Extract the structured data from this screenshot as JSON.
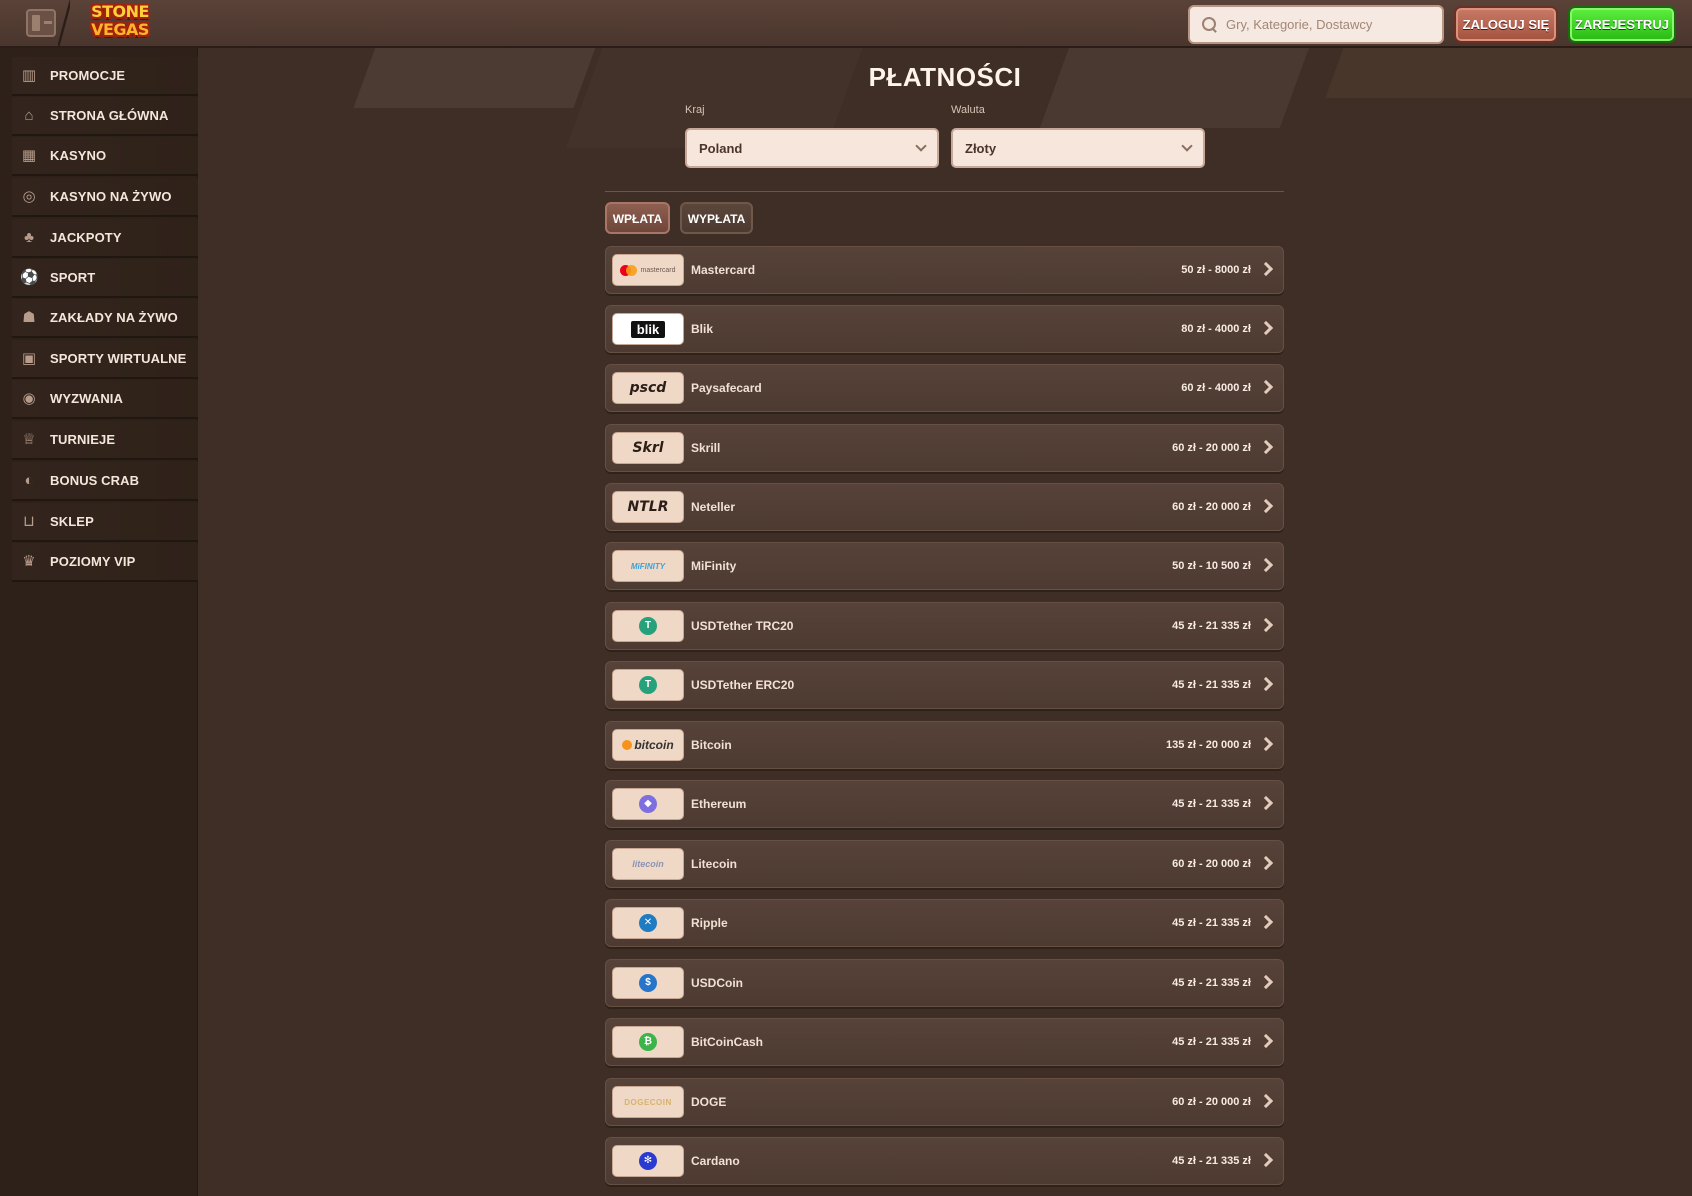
{
  "header": {
    "logo_line1": "STONE",
    "logo_line2": "VEGAS",
    "search_placeholder": "Gry, Kategorie, Dostawcy",
    "login_label": "ZALOGUJ SIĘ",
    "register_label": "ZAREJESTRUJ"
  },
  "sidebar": {
    "items": [
      {
        "label": "PROMOCJE",
        "icon": "gift-icon"
      },
      {
        "label": "STRONA GŁÓWNA",
        "icon": "home-icon"
      },
      {
        "label": "KASYNO",
        "icon": "casino-icon"
      },
      {
        "label": "KASYNO NA ŻYWO",
        "icon": "live-casino-icon"
      },
      {
        "label": "JACKPOTY",
        "icon": "clover-icon"
      },
      {
        "label": "SPORT",
        "icon": "ball-icon"
      },
      {
        "label": "ZAKŁADY NA ŻYWO",
        "icon": "live-bet-icon"
      },
      {
        "label": "SPORTY WIRTUALNE",
        "icon": "virtual-sport-icon"
      },
      {
        "label": "WYZWANIA",
        "icon": "target-icon"
      },
      {
        "label": "TURNIEJE",
        "icon": "trophy-icon"
      },
      {
        "label": "BONUS CRAB",
        "icon": "crab-icon"
      },
      {
        "label": "SKLEP",
        "icon": "basket-icon"
      },
      {
        "label": "POZIOMY VIP",
        "icon": "crown-icon"
      }
    ]
  },
  "main": {
    "title": "PŁATNOŚCI",
    "country_label": "Kraj",
    "country_value": "Poland",
    "currency_label": "Waluta",
    "currency_value": "Złoty",
    "tabs": [
      {
        "label": "WPŁATA",
        "active": true
      },
      {
        "label": "WYPŁATA",
        "active": false
      }
    ],
    "methods": [
      {
        "name": "Mastercard",
        "range": "50 zł - 8000 zł",
        "logo": "mastercard"
      },
      {
        "name": "Blik",
        "range": "80 zł - 4000 zł",
        "logo": "blik"
      },
      {
        "name": "Paysafecard",
        "range": "60 zł - 4000 zł",
        "logo": "pscd"
      },
      {
        "name": "Skrill",
        "range": "60 zł - 20 000 zł",
        "logo": "Skrl"
      },
      {
        "name": "Neteller",
        "range": "60 zł - 20 000 zł",
        "logo": "NTLR"
      },
      {
        "name": "MiFinity",
        "range": "50 zł - 10 500 zł",
        "logo": "MiFINITY"
      },
      {
        "name": "USDTether TRC20",
        "range": "45 zł - 21 335 zł",
        "logo": "tether"
      },
      {
        "name": "USDTether ERC20",
        "range": "45 zł - 21 335 zł",
        "logo": "tether"
      },
      {
        "name": "Bitcoin",
        "range": "135 zł - 20 000 zł",
        "logo": "bitcoin"
      },
      {
        "name": "Ethereum",
        "range": "45 zł - 21 335 zł",
        "logo": "ethereum"
      },
      {
        "name": "Litecoin",
        "range": "60 zł - 20 000 zł",
        "logo": "litecoin"
      },
      {
        "name": "Ripple",
        "range": "45 zł - 21 335 zł",
        "logo": "ripple"
      },
      {
        "name": "USDCoin",
        "range": "45 zł - 21 335 zł",
        "logo": "usdcoin"
      },
      {
        "name": "BitCoinCash",
        "range": "45 zł - 21 335 zł",
        "logo": "bitcoincash"
      },
      {
        "name": "DOGE",
        "range": "60 zł - 20 000 zł",
        "logo": "DOGECOIN"
      },
      {
        "name": "Cardano",
        "range": "45 zł - 21 335 zł",
        "logo": "cardano"
      }
    ]
  },
  "colors": {
    "background": "#3e2e26",
    "sidebar": "#2e2119",
    "login": "#a3513f",
    "register": "#27b913"
  }
}
